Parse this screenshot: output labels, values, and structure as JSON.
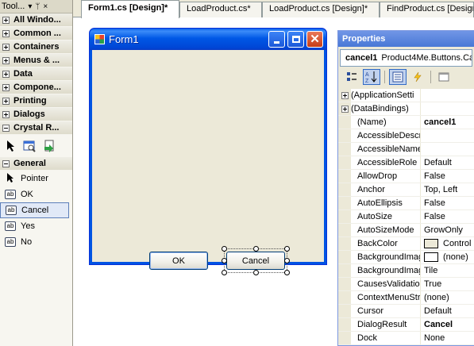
{
  "toolbox": {
    "title": "Tool...",
    "controls": {
      "dropdown": "▾",
      "pin": "ᛘ",
      "close": "×"
    },
    "categories": [
      {
        "label": "All Windo..."
      },
      {
        "label": "Common ..."
      },
      {
        "label": "Containers"
      },
      {
        "label": "Menus & ..."
      },
      {
        "label": "Data"
      },
      {
        "label": "Compone..."
      },
      {
        "label": "Printing"
      },
      {
        "label": "Dialogs"
      },
      {
        "label": "Crystal R..."
      }
    ],
    "general_label": "General",
    "items": [
      {
        "label": "Pointer",
        "icon": "pointer-icon"
      },
      {
        "label": "OK",
        "icon": "ab-icon"
      },
      {
        "label": "Cancel",
        "icon": "ab-icon",
        "selected": true
      },
      {
        "label": "Yes",
        "icon": "ab-icon"
      },
      {
        "label": "No",
        "icon": "ab-icon"
      }
    ],
    "ab_glyph": "ab"
  },
  "tabs": [
    {
      "label": "Form1.cs [Design]*",
      "active": true
    },
    {
      "label": "LoadProduct.cs*",
      "active": false
    },
    {
      "label": "LoadProduct.cs [Design]*",
      "active": false
    },
    {
      "label": "FindProduct.cs [Design]",
      "active": false
    }
  ],
  "form": {
    "title": "Form1",
    "ok_label": "OK",
    "cancel_label": "Cancel"
  },
  "properties": {
    "title": "Properties",
    "object_name": "cancel1",
    "object_type": "Product4Me.Buttons.Ca",
    "rows": [
      {
        "name": "(ApplicationSetti",
        "value": "",
        "expandable": true
      },
      {
        "name": "(DataBindings)",
        "value": "",
        "expandable": true
      },
      {
        "name": "(Name)",
        "value": "cancel1",
        "bold": true
      },
      {
        "name": "AccessibleDescri",
        "value": ""
      },
      {
        "name": "AccessibleName",
        "value": ""
      },
      {
        "name": "AccessibleRole",
        "value": "Default"
      },
      {
        "name": "AllowDrop",
        "value": "False"
      },
      {
        "name": "Anchor",
        "value": "Top, Left"
      },
      {
        "name": "AutoEllipsis",
        "value": "False"
      },
      {
        "name": "AutoSize",
        "value": "False"
      },
      {
        "name": "AutoSizeMode",
        "value": "GrowOnly"
      },
      {
        "name": "BackColor",
        "value": "Control",
        "swatch": "#ece9d8"
      },
      {
        "name": "BackgroundImag",
        "value": "(none)",
        "swatch": "#ffffff"
      },
      {
        "name": "BackgroundImag",
        "value": "Tile"
      },
      {
        "name": "CausesValidatior",
        "value": "True"
      },
      {
        "name": "ContextMenuStr",
        "value": "(none)"
      },
      {
        "name": "Cursor",
        "value": "Default"
      },
      {
        "name": "DialogResult",
        "value": "Cancel",
        "bold": true
      },
      {
        "name": "Dock",
        "value": "None"
      }
    ]
  },
  "colors": {
    "titlebar": "#0054e3",
    "selection": "#e1e9f7",
    "properties_title": "#4878d6"
  }
}
